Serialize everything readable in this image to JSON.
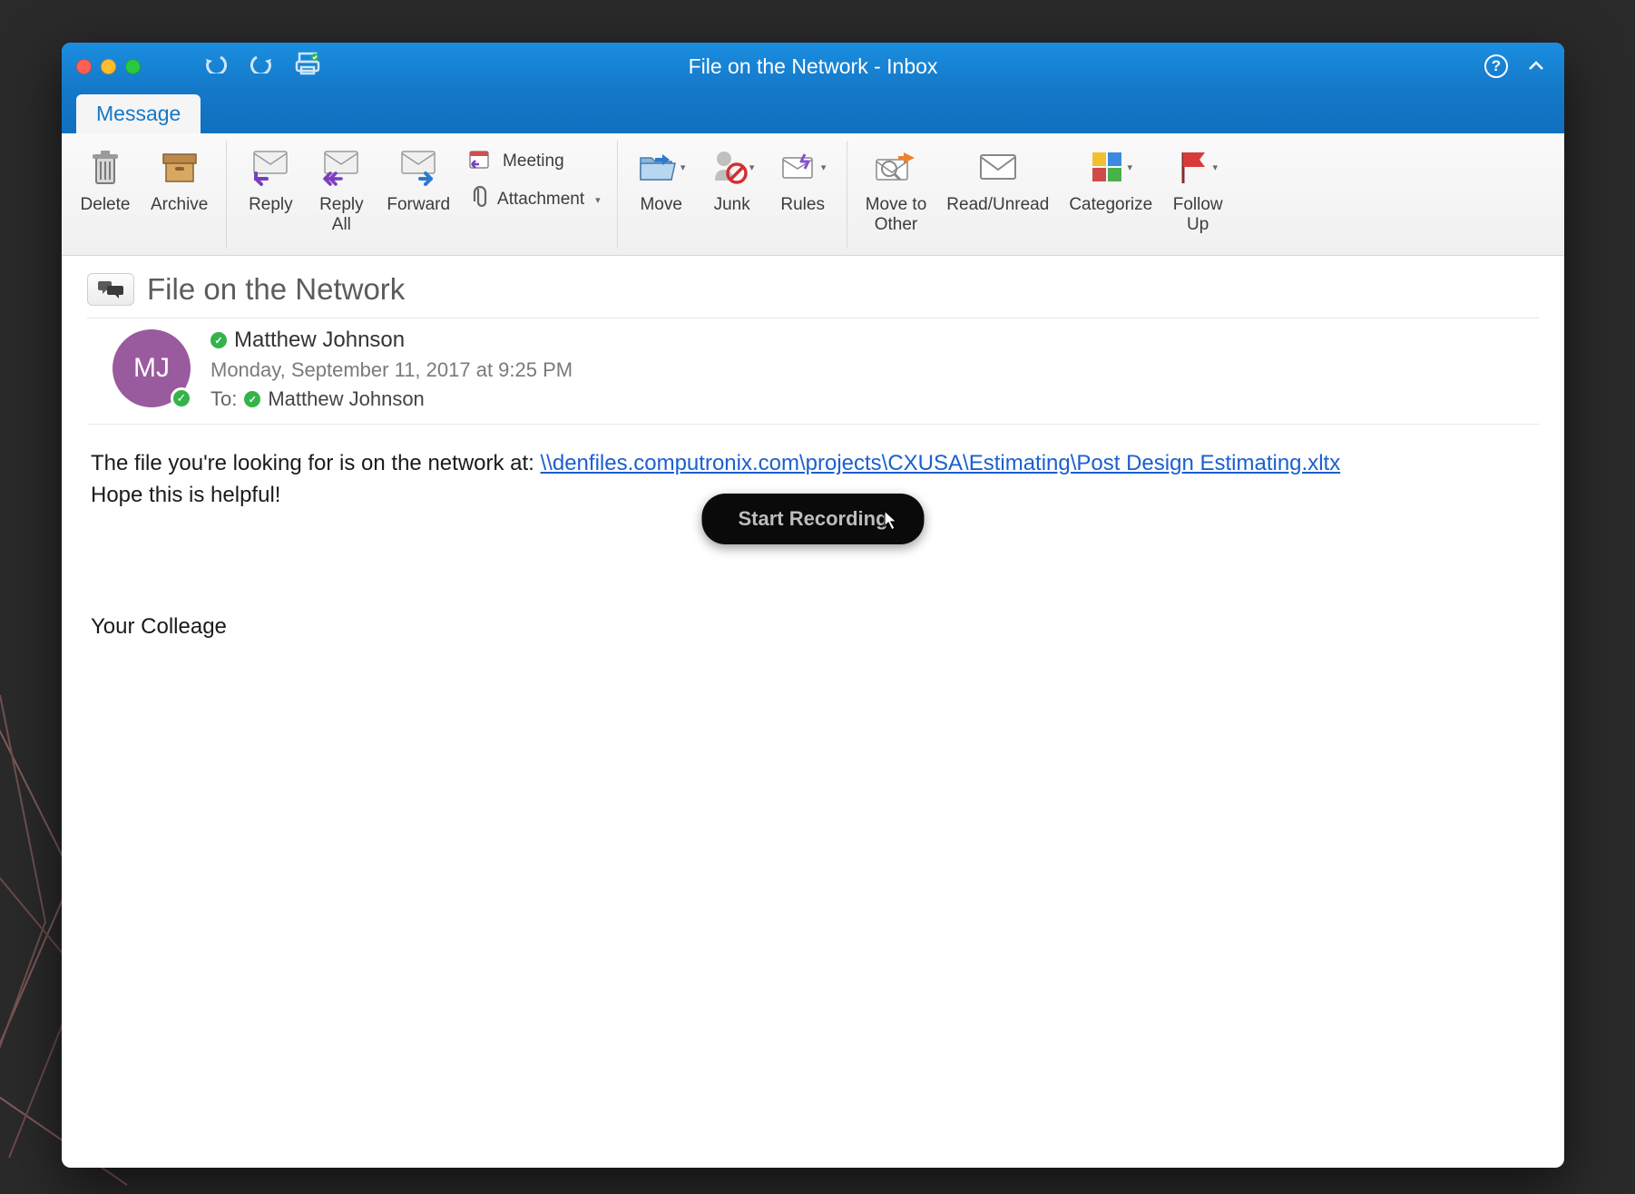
{
  "window": {
    "title": "File on the Network - Inbox"
  },
  "tabs": {
    "message": "Message"
  },
  "ribbon": {
    "delete": "Delete",
    "archive": "Archive",
    "reply": "Reply",
    "reply_all_1": "Reply",
    "reply_all_2": "All",
    "forward": "Forward",
    "meeting": "Meeting",
    "attachment": "Attachment",
    "move": "Move",
    "junk": "Junk",
    "rules": "Rules",
    "move_to_other_1": "Move to",
    "move_to_other_2": "Other",
    "read_unread": "Read/Unread",
    "categorize": "Categorize",
    "follow_up_1": "Follow",
    "follow_up_2": "Up"
  },
  "message": {
    "subject": "File on the Network",
    "avatar_initials": "MJ",
    "sender": "Matthew Johnson",
    "date": "Monday, September 11, 2017 at 9:25 PM",
    "to_label": "To:",
    "to_name": "Matthew Johnson",
    "body_prefix": "The file you're looking for is on the network at: ",
    "link": "\\\\denfiles.computronix.com\\projects\\CXUSA\\Estimating\\Post Design Estimating.xltx",
    "body_line2": "Hope this is helpful!",
    "signature": "Your Colleage"
  },
  "overlay": {
    "start_recording": "Start Recording"
  }
}
